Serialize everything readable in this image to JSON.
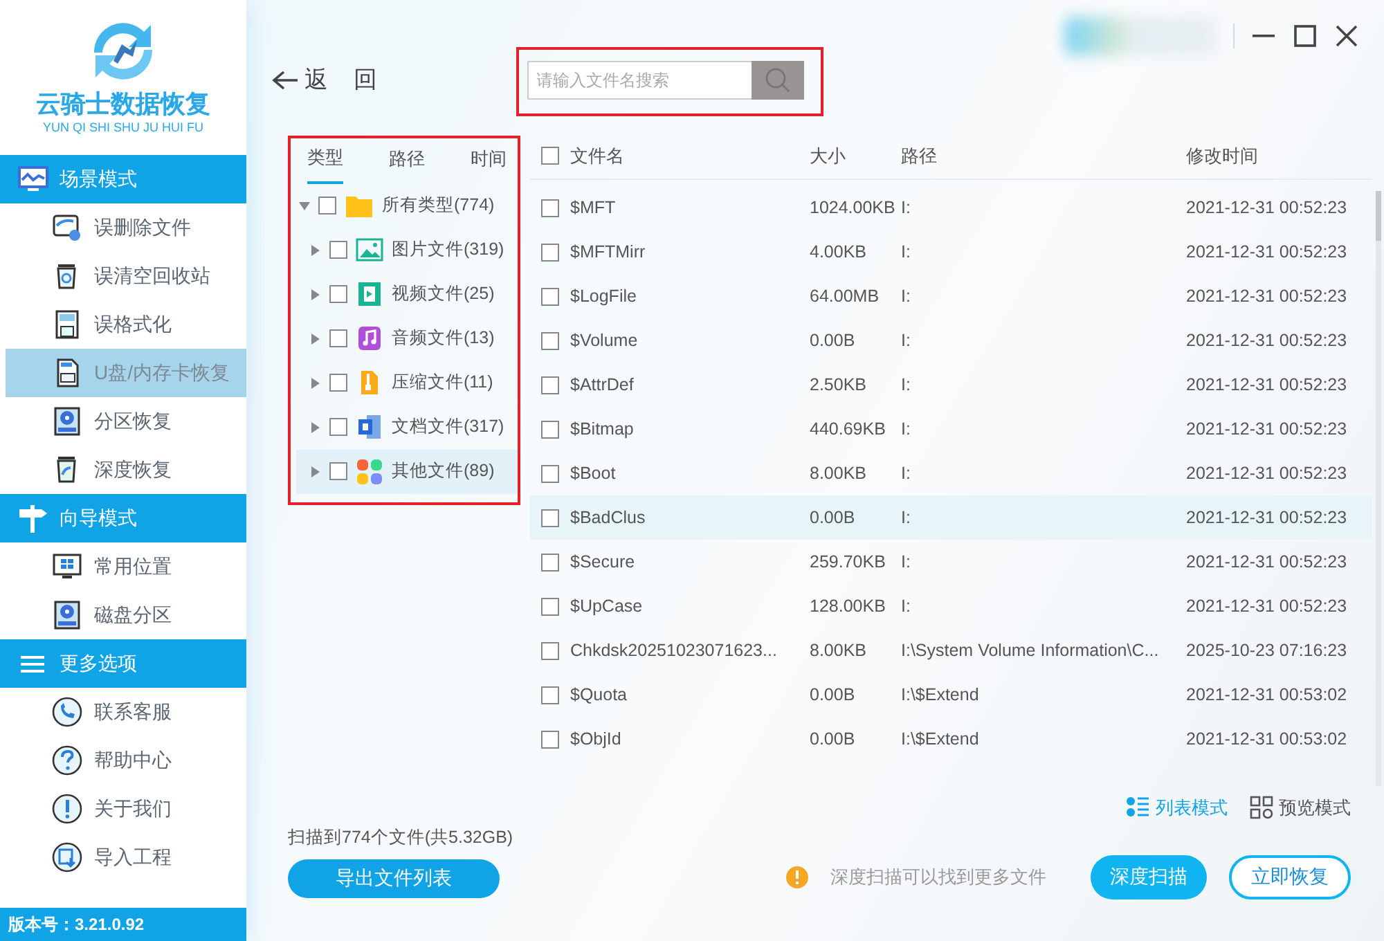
{
  "app": {
    "logo_title": "云骑士数据恢复",
    "logo_subtitle": "YUN QI SHI SHU JU HUI FU"
  },
  "sidebar": {
    "sections": [
      {
        "title": "场景模式",
        "items": [
          {
            "label": "误删除文件",
            "selected": false
          },
          {
            "label": "误清空回收站",
            "selected": false
          },
          {
            "label": "误格式化",
            "selected": false
          },
          {
            "label": "U盘/内存卡恢复",
            "selected": true
          },
          {
            "label": "分区恢复",
            "selected": false
          },
          {
            "label": "深度恢复",
            "selected": false
          }
        ]
      },
      {
        "title": "向导模式",
        "items": [
          {
            "label": "常用位置",
            "selected": false
          },
          {
            "label": "磁盘分区",
            "selected": false
          }
        ]
      },
      {
        "title": "更多选项",
        "items": [
          {
            "label": "联系客服",
            "selected": false
          },
          {
            "label": "帮助中心",
            "selected": false
          },
          {
            "label": "关于我们",
            "selected": false
          },
          {
            "label": "导入工程",
            "selected": false
          }
        ]
      }
    ],
    "version": "版本号：3.21.0.92"
  },
  "back_button": {
    "label": "返 回"
  },
  "search": {
    "placeholder": "请输入文件名搜索"
  },
  "filter_tabs": [
    {
      "label": "类型",
      "selected": true
    },
    {
      "label": "路径",
      "selected": false
    },
    {
      "label": "时间",
      "selected": false
    }
  ],
  "tree": [
    {
      "label": "所有类型(774)",
      "checked": false,
      "expanded": true,
      "selected": false,
      "children": [
        {
          "label": "图片文件(319)",
          "checked": false,
          "expanded": false,
          "selected": false
        },
        {
          "label": "视频文件(25)",
          "checked": false,
          "expanded": false,
          "selected": false
        },
        {
          "label": "音频文件(13)",
          "checked": false,
          "expanded": false,
          "selected": false
        },
        {
          "label": "压缩文件(11)",
          "checked": false,
          "expanded": false,
          "selected": false
        },
        {
          "label": "文档文件(317)",
          "checked": false,
          "expanded": false,
          "selected": false
        },
        {
          "label": "其他文件(89)",
          "checked": false,
          "expanded": false,
          "selected": true
        }
      ]
    }
  ],
  "table": {
    "select_all": {
      "checked": false
    },
    "columns": [
      "文件名",
      "大小",
      "路径",
      "修改时间"
    ],
    "rows": [
      {
        "name": "$MFT",
        "size": "1024.00KB",
        "path": "I:",
        "modified": "2021-12-31 00:52:23",
        "checked": false,
        "selected": false
      },
      {
        "name": "$MFTMirr",
        "size": "4.00KB",
        "path": "I:",
        "modified": "2021-12-31 00:52:23",
        "checked": false,
        "selected": false
      },
      {
        "name": "$LogFile",
        "size": "64.00MB",
        "path": "I:",
        "modified": "2021-12-31 00:52:23",
        "checked": false,
        "selected": false
      },
      {
        "name": "$Volume",
        "size": "0.00B",
        "path": "I:",
        "modified": "2021-12-31 00:52:23",
        "checked": false,
        "selected": false
      },
      {
        "name": "$AttrDef",
        "size": "2.50KB",
        "path": "I:",
        "modified": "2021-12-31 00:52:23",
        "checked": false,
        "selected": false
      },
      {
        "name": "$Bitmap",
        "size": "440.69KB",
        "path": "I:",
        "modified": "2021-12-31 00:52:23",
        "checked": false,
        "selected": false
      },
      {
        "name": "$Boot",
        "size": "8.00KB",
        "path": "I:",
        "modified": "2021-12-31 00:52:23",
        "checked": false,
        "selected": false
      },
      {
        "name": "$BadClus",
        "size": "0.00B",
        "path": "I:",
        "modified": "2021-12-31 00:52:23",
        "checked": false,
        "selected": true
      },
      {
        "name": "$Secure",
        "size": "259.70KB",
        "path": "I:",
        "modified": "2021-12-31 00:52:23",
        "checked": false,
        "selected": false
      },
      {
        "name": "$UpCase",
        "size": "128.00KB",
        "path": "I:",
        "modified": "2021-12-31 00:52:23",
        "checked": false,
        "selected": false
      },
      {
        "name": "Chkdsk20251023071623...",
        "size": "8.00KB",
        "path": "I:\\System Volume Information\\C...",
        "modified": "2025-10-23 07:16:23",
        "checked": false,
        "selected": false
      },
      {
        "name": "$Quota",
        "size": "0.00B",
        "path": "I:\\$Extend",
        "modified": "2021-12-31 00:53:02",
        "checked": false,
        "selected": false
      },
      {
        "name": "$ObjId",
        "size": "0.00B",
        "path": "I:\\$Extend",
        "modified": "2021-12-31 00:53:02",
        "checked": false,
        "selected": false
      }
    ]
  },
  "view_modes": [
    {
      "label": "列表模式",
      "selected": true
    },
    {
      "label": "预览模式",
      "selected": false
    }
  ],
  "scan_summary": "扫描到774个文件(共5.32GB)",
  "export_button": "导出文件列表",
  "hint": "深度扫描可以找到更多文件",
  "actions": [
    {
      "label": "深度扫描",
      "kind": "primary"
    },
    {
      "label": "立即恢复",
      "kind": "outline"
    }
  ]
}
